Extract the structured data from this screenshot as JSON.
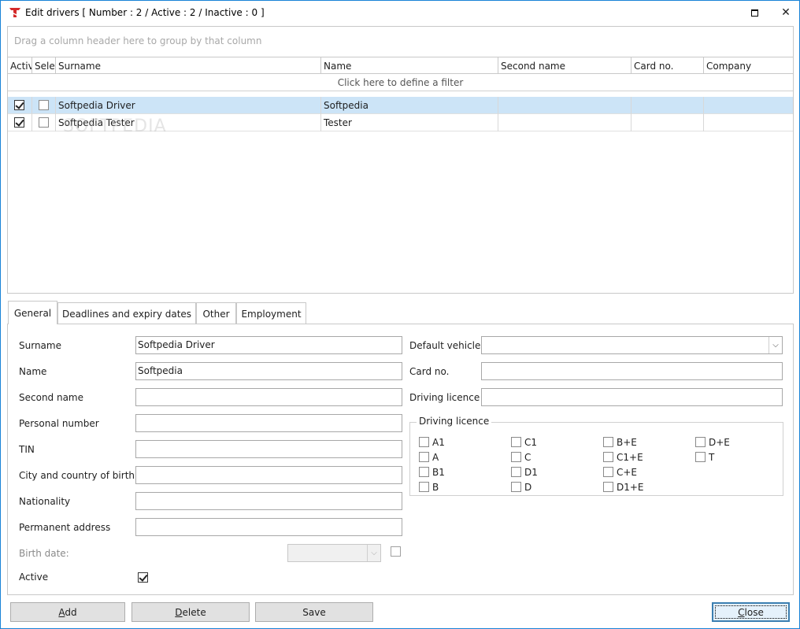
{
  "window": {
    "title": "Edit drivers [ Number : 2 / Active : 2 / Inactive : 0 ]",
    "close_glyph": "✕"
  },
  "grid": {
    "group_hint": "Drag a column header here to group by that column",
    "filter_hint": "Click here to define a filter",
    "watermark": "SOFTPEDIA",
    "columns": [
      "Active",
      "Selected",
      "Surname",
      "Name",
      "Second name",
      "Card no.",
      "Company"
    ],
    "column_display": [
      "Activ",
      "Selec",
      "Surname",
      "Name",
      "Second name",
      "Card no.",
      "Company"
    ],
    "rows": [
      {
        "active": true,
        "selected": false,
        "surname": "Softpedia Driver",
        "name": "Softpedia",
        "second_name": "",
        "card_no": "",
        "company": ""
      },
      {
        "active": true,
        "selected": false,
        "surname": "Softpedia Tester",
        "name": "Tester",
        "second_name": "",
        "card_no": "",
        "company": ""
      }
    ],
    "selected_row_index": 0
  },
  "tabs": [
    {
      "label": "General",
      "active": true
    },
    {
      "label": "Deadlines and expiry dates",
      "active": false
    },
    {
      "label": "Other",
      "active": false
    },
    {
      "label": "Employment",
      "active": false
    }
  ],
  "form": {
    "surname_label": "Surname",
    "surname_value": "Softpedia Driver",
    "name_label": "Name",
    "name_value": "Softpedia",
    "second_name_label": "Second name",
    "second_name_value": "",
    "personal_number_label": "Personal number",
    "personal_number_value": "",
    "tin_label": "TIN",
    "tin_value": "",
    "city_country_label": "City and country of birth",
    "city_country_value": "",
    "nationality_label": "Nationality",
    "nationality_value": "",
    "permanent_address_label": "Permanent address",
    "permanent_address_value": "",
    "birth_date_label": "Birth date:",
    "birth_date_value": "",
    "birth_date_enabled": false,
    "active_label": "Active",
    "active_checked": true,
    "default_vehicle_label": "Default vehicle",
    "default_vehicle_value": "",
    "card_no_label": "Card no.",
    "card_no_value": "",
    "driving_licence_label": "Driving licence",
    "driving_licence_value": "",
    "licence_group_title": "Driving licence",
    "licence_categories": [
      {
        "label": "A1",
        "checked": false
      },
      {
        "label": "A",
        "checked": false
      },
      {
        "label": "B1",
        "checked": false
      },
      {
        "label": "B",
        "checked": false
      },
      {
        "label": "C1",
        "checked": false
      },
      {
        "label": "C",
        "checked": false
      },
      {
        "label": "D1",
        "checked": false
      },
      {
        "label": "D",
        "checked": false
      },
      {
        "label": "B+E",
        "checked": false
      },
      {
        "label": "C1+E",
        "checked": false
      },
      {
        "label": "C+E",
        "checked": false
      },
      {
        "label": "D1+E",
        "checked": false
      },
      {
        "label": "D+E",
        "checked": false
      },
      {
        "label": "T",
        "checked": false
      }
    ]
  },
  "buttons": {
    "add": {
      "first": "A",
      "rest": "dd"
    },
    "delete": {
      "first": "D",
      "rest": "elete"
    },
    "save": "Save",
    "close": {
      "first": "C",
      "rest": "lose"
    }
  },
  "icons": {
    "app": "red-t-app-icon",
    "maximize": "maximize-icon",
    "close": "close-icon",
    "combo_arrow": "chevron-down-icon",
    "check": "check-icon"
  },
  "colors": {
    "window_border": "#1883d7",
    "selected_row": "#cce4f7",
    "default_button_border": "#3c7fb1",
    "app_icon": "#d42a2a"
  }
}
